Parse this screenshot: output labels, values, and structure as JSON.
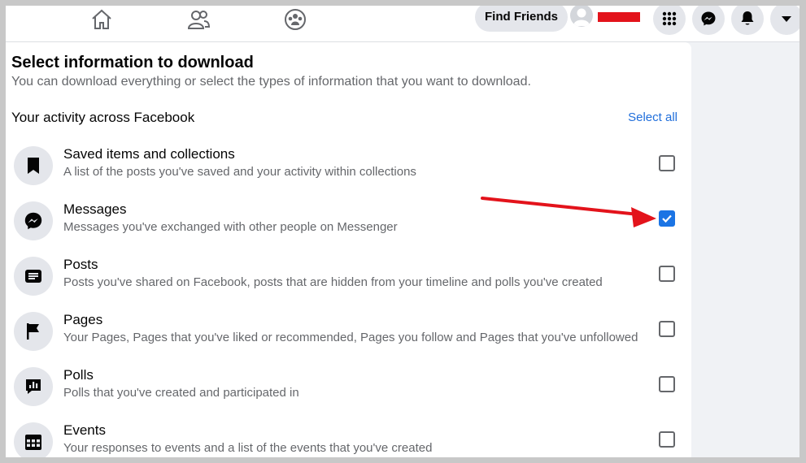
{
  "nav": {
    "find_friends_label": "Find Friends",
    "icons": [
      "home-icon",
      "friends-icon",
      "groups-icon",
      "menu-grid-icon",
      "messenger-icon",
      "notifications-icon",
      "account-caret-icon"
    ]
  },
  "panel": {
    "title": "Select information to download",
    "subtitle": "You can download everything or select the types of information that you want to download.",
    "section_title": "Your activity across Facebook",
    "select_all_label": "Select all",
    "items": [
      {
        "title": "Saved items and collections",
        "description": "A list of the posts you've saved and your activity within collections",
        "icon": "bookmark-icon",
        "checked": false
      },
      {
        "title": "Messages",
        "description": "Messages you've exchanged with other people on Messenger",
        "icon": "messenger-icon",
        "checked": true
      },
      {
        "title": "Posts",
        "description": "Posts you've shared on Facebook, posts that are hidden from your timeline and polls you've created",
        "icon": "posts-icon",
        "checked": false
      },
      {
        "title": "Pages",
        "description": "Your Pages, Pages that you've liked or recommended, Pages you follow and Pages that you've unfollowed",
        "icon": "flag-icon",
        "checked": false
      },
      {
        "title": "Polls",
        "description": "Polls that you've created and participated in",
        "icon": "poll-icon",
        "checked": false
      },
      {
        "title": "Events",
        "description": "Your responses to events and a list of the events that you've created",
        "icon": "calendar-icon",
        "checked": false
      }
    ]
  },
  "colors": {
    "accent": "#1b74e4",
    "link": "#216fdb",
    "annotation_arrow": "#e3131b",
    "redaction": "#e3131b"
  }
}
